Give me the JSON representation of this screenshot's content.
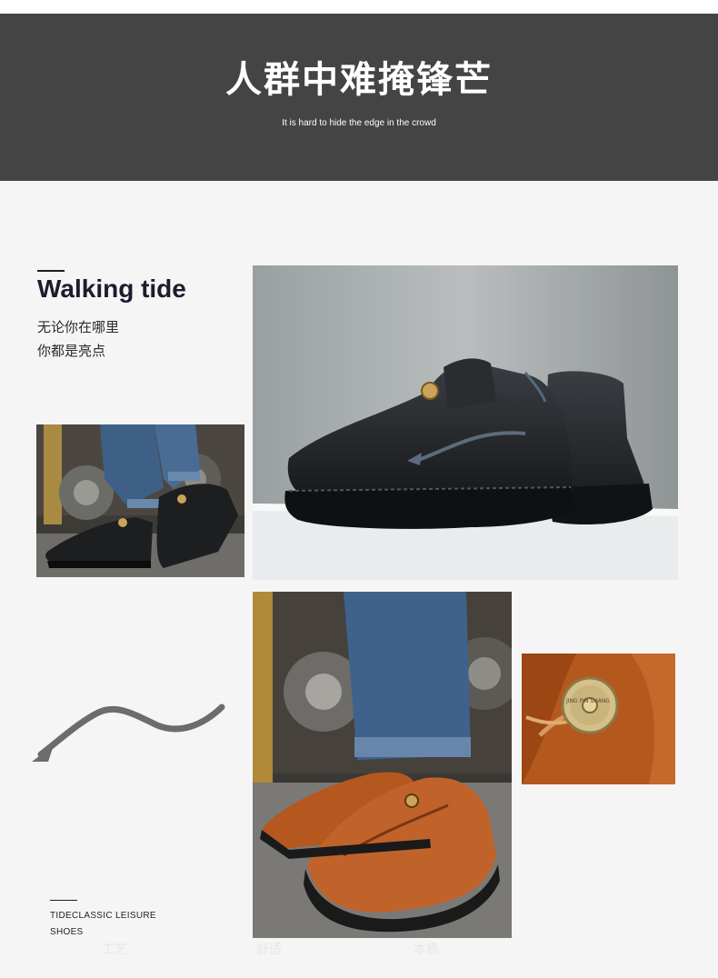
{
  "banner": {
    "title": "人群中难掩锋芒",
    "subtitle": "It is hard to hide the edge in the crowd"
  },
  "feature": {
    "heading": "Walking tide",
    "line1": "无论你在哪里",
    "line2": "你都是亮点"
  },
  "footer": {
    "line1": "TIDECLASSIC LEISURE",
    "line2": "SHOES"
  },
  "ghost_labels": [
    "工艺",
    "舒适",
    "本质"
  ],
  "badge": {
    "text": "JING PIN SHANG"
  },
  "colors": {
    "banner_bg": "#444444",
    "page_bg": "#f5f5f6",
    "black_leather": "#1e2023",
    "brown_leather": "#b4581f"
  },
  "icons": {
    "arrow": "curved-arrow-icon"
  }
}
